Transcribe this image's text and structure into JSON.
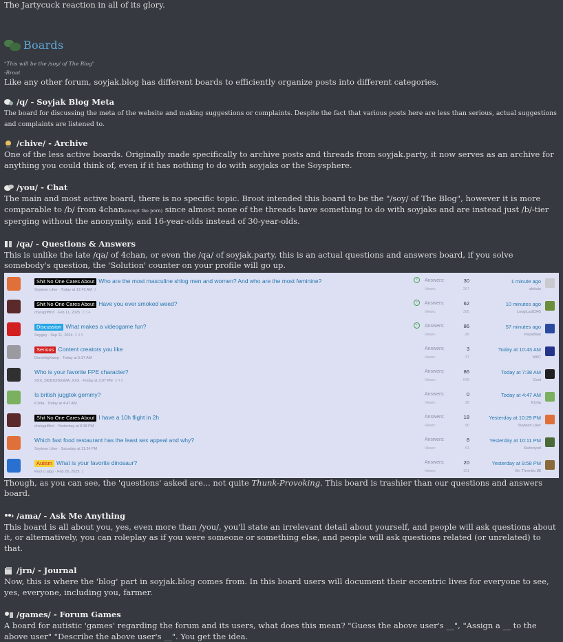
{
  "intro_line": "The Jartycuck reaction in all of its glory.",
  "boards_section": {
    "title": "Boards",
    "quote": "\"This will be the /soy/ of The Blog\"",
    "quote_author": "-Broot",
    "intro": "Like any other forum, soyjak.blog has different boards to efficiently organize posts into different categories."
  },
  "boards": [
    {
      "name": "/q/ - Soyjak Blog Meta",
      "desc": "The board for discussing the meta of the website and making suggestions or complaints. Despite the fact that various posts here are less than serious, actual suggestions and complaints are listened to."
    },
    {
      "name": "/chive/ - Archive",
      "desc": "One of the less active boards. Originally made specifically to archive posts and threads from soyjak.party, it now serves as an archive for anything you could think of, even if it has nothing to do with soyjaks or the Soysphere."
    },
    {
      "name": "/you/ - Chat",
      "desc_a": "The main and most active board, there is no specific topic. Broot intended this board to be the \"/soy/ of The Blog\", however it is more comparable to /b/ from 4chan",
      "desc_small": "(except the porn)",
      "desc_b": " since almost none of the threads have something to do with soyjaks and are instead just /b/-tier sperging without the anonymity, and 16-year-olds instead of 30-year-olds."
    },
    {
      "name": "/qa/ - Questions & Answers",
      "desc": "This is unlike the late /qa/ of 4chan, or even the /qa/ of soyjak.party, this is an actual questions and answers board, if you solve somebody's question, the 'Solution' counter on your profile will go up."
    }
  ],
  "forum_labels": {
    "answers": "Answers:",
    "views": "Views:"
  },
  "threads": [
    {
      "prefix": "Shit No One Cares About",
      "prefix_style": "black",
      "title": "Who are the most masculine shlog men and women? And who are the most feminine?",
      "meta": "Soyteen Liker · Today at 12:45 AM",
      "pages": "2",
      "solved": true,
      "answers": "30",
      "views": "267",
      "when": "1 minute ago",
      "who": "aleksio",
      "av": "#e0703a",
      "av2": "#c8cad0"
    },
    {
      "prefix": "Shit No One Cares About",
      "prefix_style": "black",
      "title": "Have you ever smoked weed?",
      "meta": "chelsgriffinrl · Feb 11, 2025",
      "pages": "2 3 4",
      "solved": true,
      "answers": "62",
      "views": "395",
      "when": "10 minutes ago",
      "who": "LoogiLad2345",
      "av": "#5a2a2a",
      "av2": "#6b8e3a"
    },
    {
      "prefix": "Discussion",
      "prefix_style": "blue",
      "title": "What makes a videogame fun?",
      "meta": "Soygoy · Sep 11, 2024",
      "pages": "3 4 5",
      "solved": true,
      "answers": "86",
      "views": "2K",
      "when": "57 minutes ago",
      "who": "PepsiMan",
      "av": "#d22020",
      "av2": "#2a4aa0"
    },
    {
      "prefix": "Serious",
      "prefix_style": "red",
      "title": "Content creators you like",
      "meta": "DendeligKamp · Today at 5:37 AM",
      "pages": "",
      "solved": false,
      "answers": "3",
      "views": "37",
      "when": "Today at 10:43 AM",
      "who": "MKC",
      "av": "#9a9aa0",
      "av2": "#24348a"
    },
    {
      "prefix": "",
      "prefix_style": "",
      "title": "Who is your favorite FPE character?",
      "meta": "XXX_SKIBIDISIGMA_XXX · Friday at 3:07 PM",
      "pages": "3 4 5",
      "solved": false,
      "answers": "86",
      "views": "649",
      "when": "Today at 7:38 AM",
      "who": "Goot",
      "av": "#303030",
      "av2": "#202020"
    },
    {
      "prefix": "",
      "prefix_style": "",
      "title": "Is british juggtok gemmy?",
      "meta": "K1rita · Today at 4:47 AM",
      "pages": "",
      "solved": false,
      "answers": "0",
      "views": "26",
      "when": "Today at 4:47 AM",
      "who": "K1rita",
      "av": "#7ab060",
      "av2": "#7ab060"
    },
    {
      "prefix": "Shit No One Cares About",
      "prefix_style": "black",
      "title": "I have a 10h flight in 2h",
      "meta": "chelsgriffinrl · Yesterday at 9:18 PM",
      "pages": "",
      "solved": false,
      "answers": "18",
      "views": "90",
      "when": "Yesterday at 10:29 PM",
      "who": "Soyteen Liker",
      "av": "#5a2a2a",
      "av2": "#e0703a"
    },
    {
      "prefix": "",
      "prefix_style": "",
      "title": "Which fast food restaurant has the least sex appeal and why?",
      "meta": "Soyteen Liker · Saturday at 11:24 PM",
      "pages": "",
      "solved": false,
      "answers": "8",
      "views": "51",
      "when": "Yesterday at 10:11 PM",
      "who": "Xiuhcoyotl",
      "av": "#e0703a",
      "av2": "#4a6a3a"
    },
    {
      "prefix": "Autism",
      "prefix_style": "yellow",
      "title": "What is your favorite dinosaur?",
      "meta": "Root o algo · Feb 26, 2025",
      "pages": "2",
      "solved": false,
      "answers": "20",
      "views": "121",
      "when": "Yesterday at 9:58 PM",
      "who": "Mr. Threnbo 88",
      "av": "#2a70d0",
      "av2": "#8a6a3a"
    }
  ],
  "after_forum": {
    "a": "Though, as you can see, the 'questions' asked are... not quite ",
    "italic": "Thunk-Provoking",
    "b": ". This board is trashier than our questions and answers board."
  },
  "boards2": [
    {
      "name": "/ama/ - Ask Me Anything",
      "desc": "This board is all about you, yes, even more than /you/, you'll state an irrelevant detail about yourself, and people will ask questions about it, or alternatively, you can roleplay as if you were someone or something else, and people will ask questions related (or unrelated) to that."
    },
    {
      "name": "/jrn/ - Journal",
      "desc": "Now, this is where the 'blog' part in soyjak.blog comes from. In this board users will document their eccentric lives for everyone to see, yes, everyone, including you, farmer."
    },
    {
      "name": "/games/ - Forum Games",
      "desc": "A board for autistic 'games' regarding the forum and its users, what does this mean? \"Guess the above user's __\", \"Assign a __ to the above user\" \"Describe the above user's __\". You get the idea."
    }
  ],
  "colors": {
    "bg": "#36393f",
    "text": "#dcddde",
    "heading": "#5ea8d8",
    "link": "#2577b1"
  }
}
